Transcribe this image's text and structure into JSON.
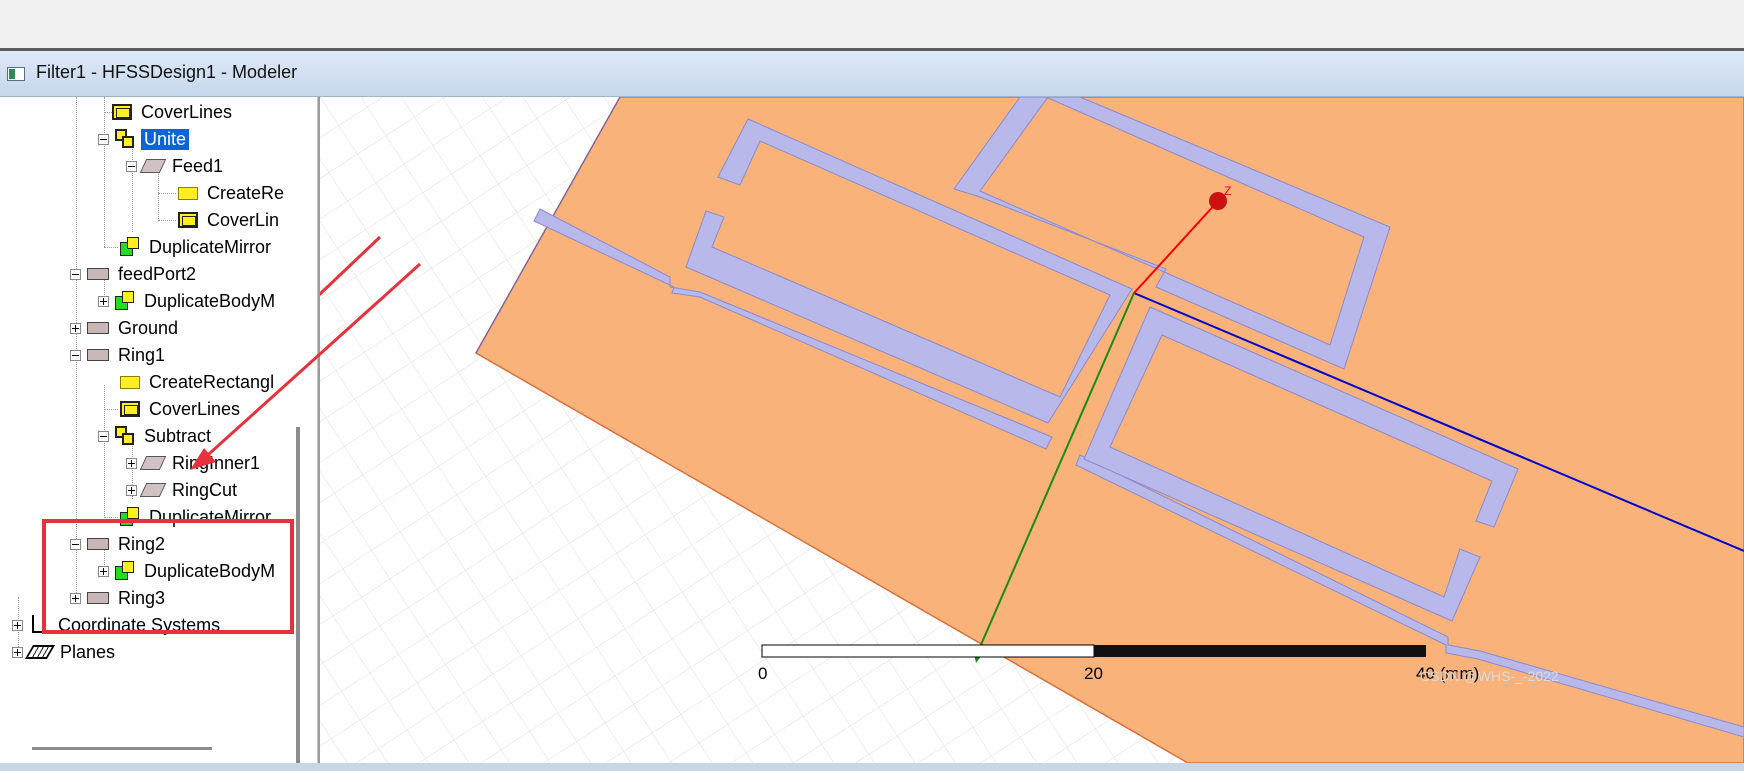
{
  "window": {
    "title": "Filter1 - HFSSDesign1 - Modeler"
  },
  "tree": {
    "items": [
      {
        "label": "CoverLines",
        "icon": "cover-lines-icon"
      },
      {
        "label": "Unite",
        "icon": "unite-icon",
        "selected": true
      },
      {
        "label": "Feed1",
        "icon": "sheet-icon"
      },
      {
        "label": "CreateRe",
        "icon": "create-rectangle-icon"
      },
      {
        "label": "CoverLin",
        "icon": "cover-lines-icon"
      },
      {
        "label": "DuplicateMirror",
        "icon": "duplicate-mirror-icon"
      },
      {
        "label": "feedPort2",
        "icon": "solid-body-icon"
      },
      {
        "label": "DuplicateBodyM",
        "icon": "duplicate-body-icon"
      },
      {
        "label": "Ground",
        "icon": "solid-body-icon"
      },
      {
        "label": "Ring1",
        "icon": "solid-body-icon"
      },
      {
        "label": "CreateRectangl",
        "icon": "create-rectangle-icon"
      },
      {
        "label": "CoverLines",
        "icon": "cover-lines-icon"
      },
      {
        "label": "Subtract",
        "icon": "subtract-icon"
      },
      {
        "label": "RingInner1",
        "icon": "sheet-icon"
      },
      {
        "label": "RingCut",
        "icon": "sheet-icon"
      },
      {
        "label": "DuplicateMirror",
        "icon": "duplicate-mirror-icon"
      },
      {
        "label": "Ring2",
        "icon": "solid-body-icon"
      },
      {
        "label": "DuplicateBodyM",
        "icon": "duplicate-body-icon"
      },
      {
        "label": "Ring3",
        "icon": "solid-body-icon"
      },
      {
        "label": "Coordinate Systems",
        "icon": "coordinate-systems-icon"
      },
      {
        "label": "Planes",
        "icon": "planes-icon"
      }
    ]
  },
  "viewport": {
    "scale_bar": {
      "tick_0": "0",
      "tick_1": "20",
      "tick_2": "40 (mm)"
    },
    "axis_label": "Z",
    "watermark": "CSDN @WHS-_-2022"
  },
  "colors": {
    "substrate": "#f8b27a",
    "trace": "#b8b8ea",
    "selection": "#0a66d6",
    "annotation": "#e8323b",
    "axis_x": "#ff0000",
    "axis_y": "#0000cc",
    "axis_z": "#1a8a1a"
  }
}
